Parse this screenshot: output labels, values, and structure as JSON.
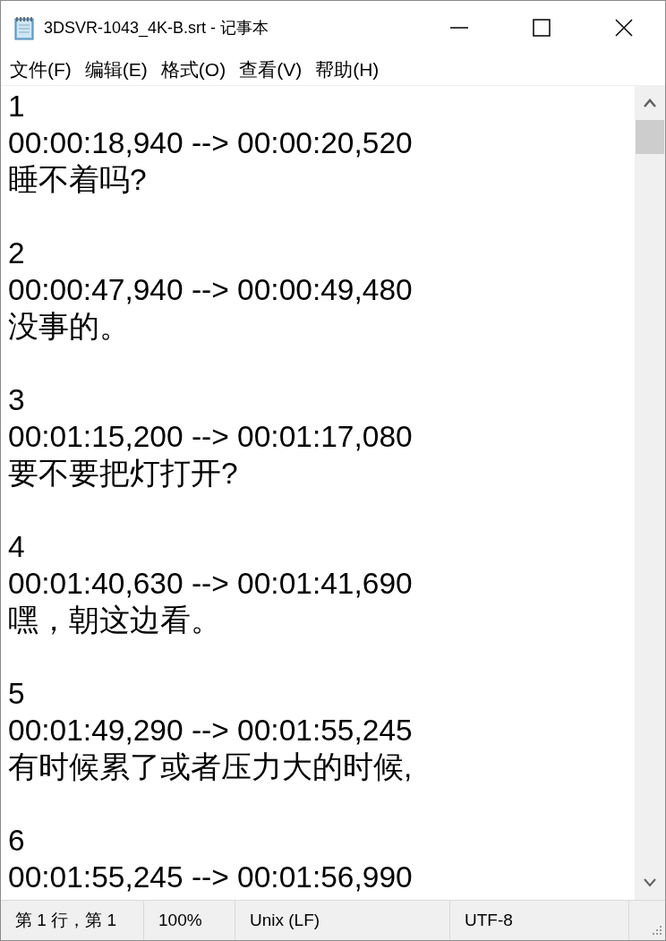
{
  "window": {
    "title": "3DSVR-1043_4K-B.srt - 记事本"
  },
  "menu": [
    "文件(F)",
    "编辑(E)",
    "格式(O)",
    "查看(V)",
    "帮助(H)"
  ],
  "cues": [
    {
      "index": "1",
      "time": "00:00:18,940 --> 00:00:20,520",
      "text": "睡不着吗?"
    },
    {
      "index": "2",
      "time": "00:00:47,940 --> 00:00:49,480",
      "text": "没事的。"
    },
    {
      "index": "3",
      "time": "00:01:15,200 --> 00:01:17,080",
      "text": "要不要把灯打开?"
    },
    {
      "index": "4",
      "time": "00:01:40,630 --> 00:01:41,690",
      "text": "嘿，朝这边看。"
    },
    {
      "index": "5",
      "time": "00:01:49,290 --> 00:01:55,245",
      "text": "有时候累了或者压力大的时候,"
    },
    {
      "index": "6",
      "time": "00:01:55,245 --> 00:01:56,990"
    }
  ],
  "status_bar": [
    "第 1 行，第 1",
    "100%",
    "Unix (LF)",
    "UTF-8"
  ]
}
